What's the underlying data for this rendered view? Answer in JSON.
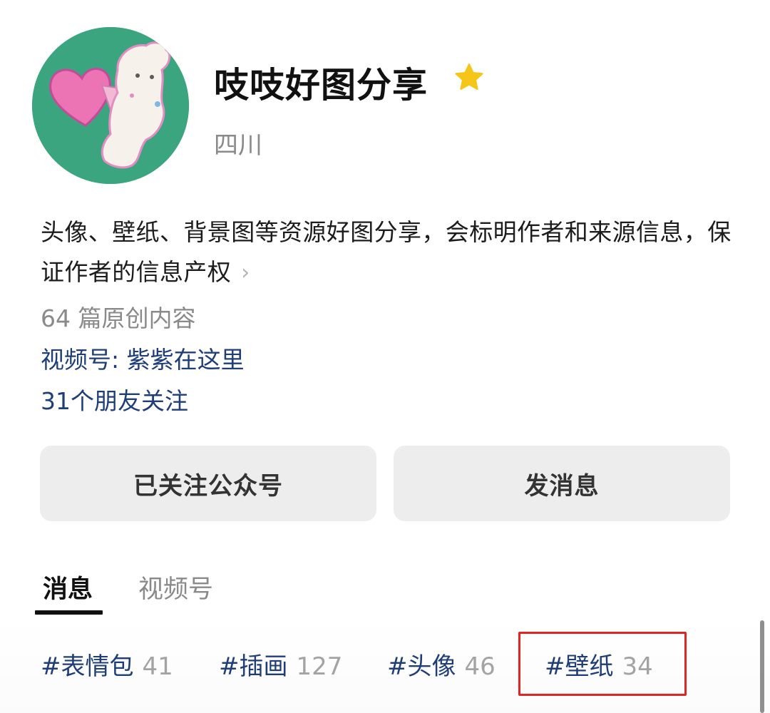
{
  "profile": {
    "name": "吱吱好图分享",
    "location": "四川",
    "description": "头像、壁纸、背景图等资源好图分享，会标明作者和来源信息，保证作者的信息产权",
    "original_count": "64 篇原创内容",
    "channels_link": "视频号: 紫紫在这里",
    "friends_follow": "31个朋友关注"
  },
  "actions": {
    "follow_label": "已关注公众号",
    "message_label": "发消息"
  },
  "tabs": [
    {
      "label": "消息",
      "active": true
    },
    {
      "label": "视频号",
      "active": false
    }
  ],
  "hashtags": [
    {
      "name": "#表情包",
      "count": "41"
    },
    {
      "name": "#插画",
      "count": "127"
    },
    {
      "name": "#头像",
      "count": "46"
    },
    {
      "name": "#壁纸",
      "count": "34",
      "highlighted": true
    }
  ],
  "icons": {
    "star": "star-icon",
    "chevron": "chevron-right-icon"
  },
  "colors": {
    "accent_link": "#1f3e78",
    "star": "#f5c518",
    "avatar_bg": "#3aa57f",
    "highlight_border": "#e02525",
    "button_bg": "#ededed"
  }
}
